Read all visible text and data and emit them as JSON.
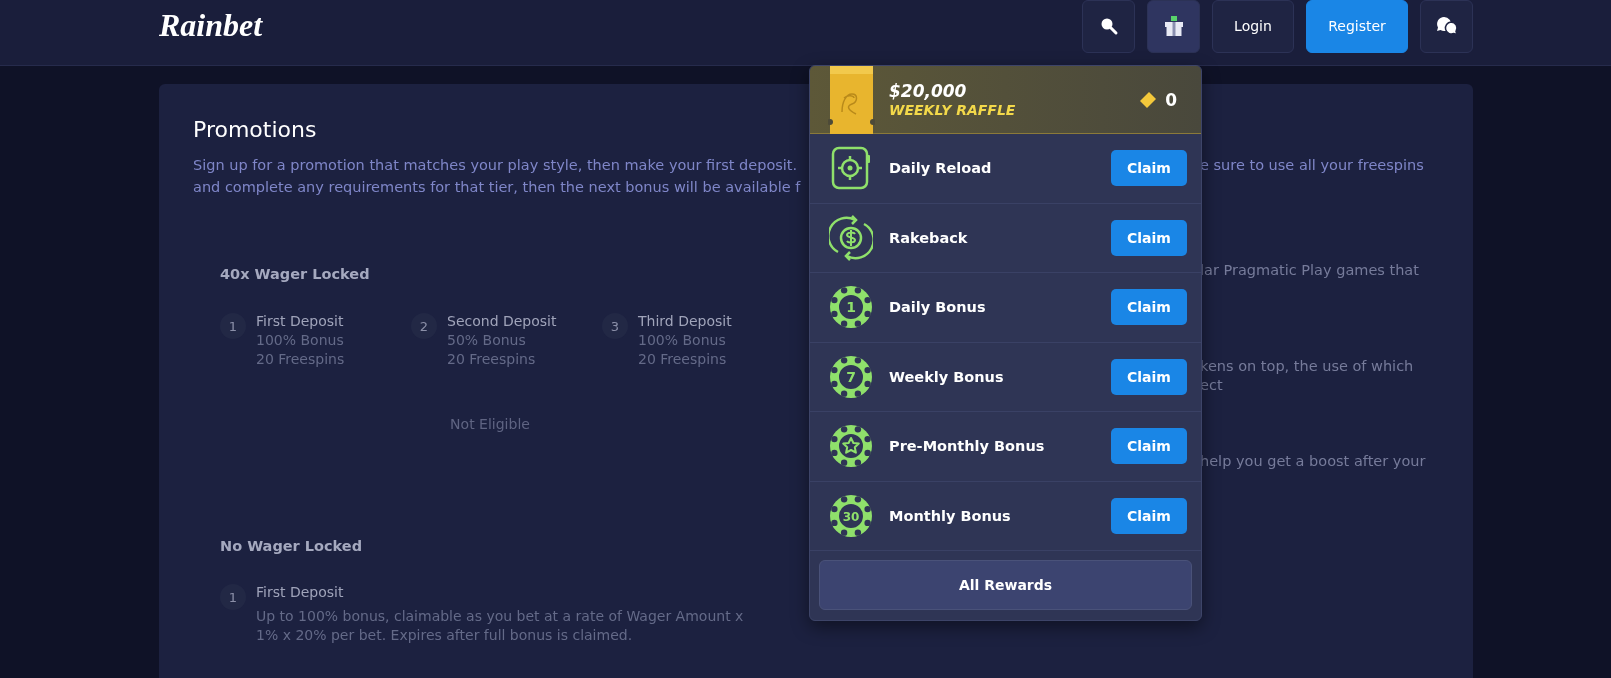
{
  "header": {
    "logo": "Rainbet",
    "actions": [
      {
        "kind": "search",
        "active": false
      },
      {
        "kind": "gift",
        "active": true
      },
      {
        "kind": "login",
        "label": "Login",
        "active": false
      },
      {
        "kind": "register",
        "label": "Register",
        "active": false
      },
      {
        "kind": "chat",
        "active": false
      }
    ]
  },
  "promotions": {
    "title": "Promotions",
    "intro_left": [
      "Sign up for a promotion that matches your play style, then make your first deposit.",
      "and complete any requirements for that tier, then the next bonus will be available f"
    ],
    "intro_right": "e sure to use all your freespins",
    "side_fragments": [
      [
        "lar Pragmatic Play games that"
      ],
      [
        "kens on top, the use of which",
        "ect"
      ],
      [
        "help you get a boost after your"
      ]
    ],
    "sections": [
      {
        "title": "40x Wager Locked",
        "status": "Not Eligible",
        "steps": [
          {
            "number": "1",
            "title": "First Deposit",
            "lines": [
              "100% Bonus",
              "20 Freespins"
            ]
          },
          {
            "number": "2",
            "title": "Second Deposit",
            "lines": [
              "50% Bonus",
              "20 Freespins"
            ]
          },
          {
            "number": "3",
            "title": "Third Deposit",
            "lines": [
              "100% Bonus",
              "20 Freespins"
            ]
          }
        ]
      },
      {
        "title": "No Wager Locked",
        "steps": [
          {
            "number": "1",
            "title": "First Deposit",
            "lines": [
              "Up to 100% bonus, claimable as you bet at a rate of Wager Amount x 1% x 20% per bet. Expires after full bonus is claimed."
            ]
          }
        ]
      }
    ]
  },
  "rewards_menu": {
    "raffle": {
      "amount": "$20,000",
      "label": "WEEKLY RAFFLE",
      "tickets": "0"
    },
    "rewards": [
      {
        "kind": "reload",
        "name": "Daily Reload",
        "button": "Claim"
      },
      {
        "kind": "rakeback",
        "name": "Rakeback",
        "button": "Claim"
      },
      {
        "kind": "chip",
        "badge": "1",
        "name": "Daily Bonus",
        "button": "Claim"
      },
      {
        "kind": "chip",
        "badge": "7",
        "name": "Weekly Bonus",
        "button": "Claim"
      },
      {
        "kind": "star",
        "name": "Pre-Monthly Bonus",
        "button": "Claim"
      },
      {
        "kind": "chip",
        "badge": "30",
        "name": "Monthly Bonus",
        "button": "Claim"
      }
    ],
    "footer_button": "All Rewards"
  }
}
